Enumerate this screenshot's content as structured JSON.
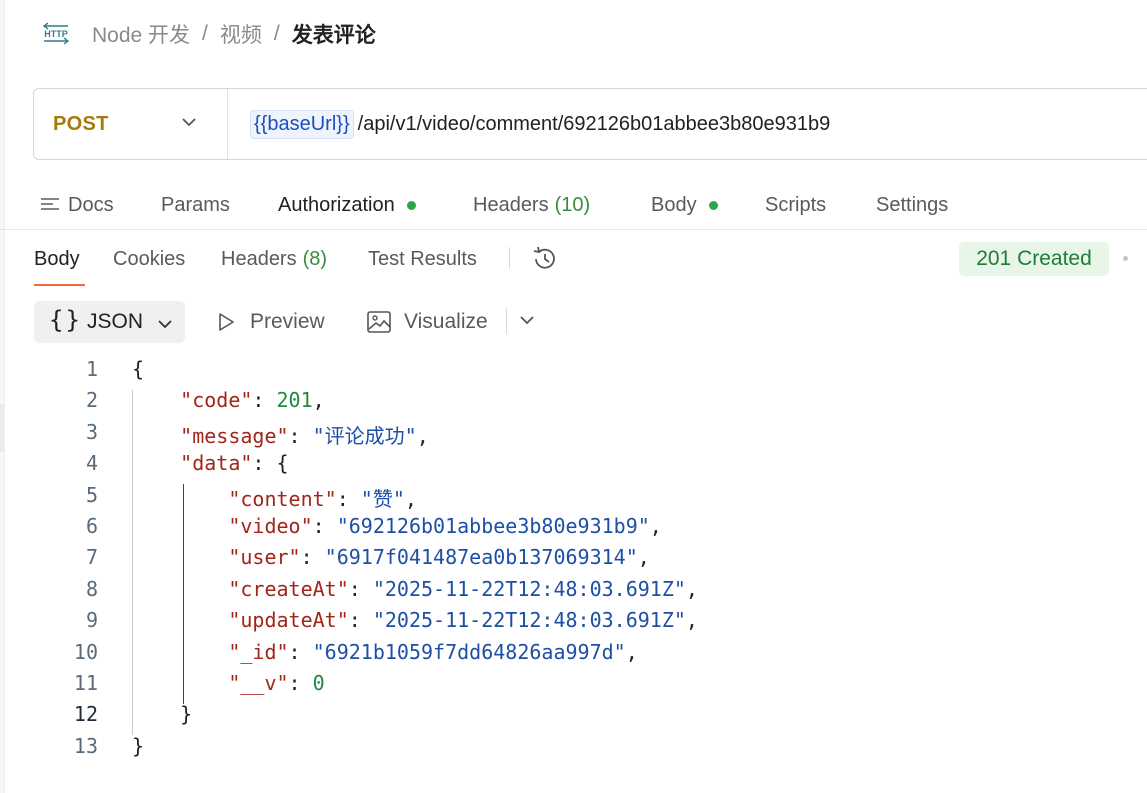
{
  "breadcrumb": {
    "items": [
      "Node 开发",
      "视频"
    ],
    "separator": "/",
    "current": "发表评论"
  },
  "request": {
    "method": "POST",
    "url_variable": "{{baseUrl}}",
    "url_path": "/api/v1/video/comment/692126b01abbee3b80e931b9"
  },
  "request_tabs": {
    "docs": "Docs",
    "params": "Params",
    "authorization": "Authorization",
    "headers": "Headers",
    "headers_count": "(10)",
    "body": "Body",
    "scripts": "Scripts",
    "settings": "Settings"
  },
  "response_tabs": {
    "body": "Body",
    "cookies": "Cookies",
    "headers": "Headers",
    "headers_count": "(8)",
    "test_results": "Test Results"
  },
  "status": "201 Created",
  "view": {
    "format": "JSON",
    "preview": "Preview",
    "visualize": "Visualize"
  },
  "code": {
    "line_numbers": [
      "1",
      "2",
      "3",
      "4",
      "5",
      "6",
      "7",
      "8",
      "9",
      "10",
      "11",
      "12",
      "13"
    ],
    "lines": [
      {
        "indent": "",
        "key": "",
        "value": "",
        "text": "{"
      },
      {
        "indent": "    ",
        "key": "\"code\"",
        "value": "201",
        "vtype": "n",
        "suffix": ","
      },
      {
        "indent": "    ",
        "key": "\"message\"",
        "value": "\"评论成功\"",
        "vtype": "s",
        "suffix": ","
      },
      {
        "indent": "    ",
        "key": "\"data\"",
        "value": "",
        "open": "{"
      },
      {
        "indent": "        ",
        "key": "\"content\"",
        "value": "\"赞\"",
        "vtype": "s",
        "suffix": ","
      },
      {
        "indent": "        ",
        "key": "\"video\"",
        "value": "\"692126b01abbee3b80e931b9\"",
        "vtype": "s",
        "suffix": ","
      },
      {
        "indent": "        ",
        "key": "\"user\"",
        "value": "\"6917f041487ea0b137069314\"",
        "vtype": "s",
        "suffix": ","
      },
      {
        "indent": "        ",
        "key": "\"createAt\"",
        "value": "\"2025-11-22T12:48:03.691Z\"",
        "vtype": "s",
        "suffix": ","
      },
      {
        "indent": "        ",
        "key": "\"updateAt\"",
        "value": "\"2025-11-22T12:48:03.691Z\"",
        "vtype": "s",
        "suffix": ","
      },
      {
        "indent": "        ",
        "key": "\"_id\"",
        "value": "\"6921b1059f7dd64826aa997d\"",
        "vtype": "s",
        "suffix": ","
      },
      {
        "indent": "        ",
        "key": "\"__v\"",
        "value": "0",
        "vtype": "n",
        "suffix": ""
      },
      {
        "indent": "    ",
        "key": "",
        "value": "",
        "text": "}"
      },
      {
        "indent": "",
        "key": "",
        "value": "",
        "text": "}"
      }
    ]
  },
  "colors": {
    "method": "#a77b0b",
    "accent_underline": "#f26b3a",
    "status_bg": "#e8f6ea",
    "status_text": "#1e7d34",
    "json_key": "#a1261a",
    "json_string": "#1d4fa6",
    "json_number": "#1f8a3c"
  }
}
